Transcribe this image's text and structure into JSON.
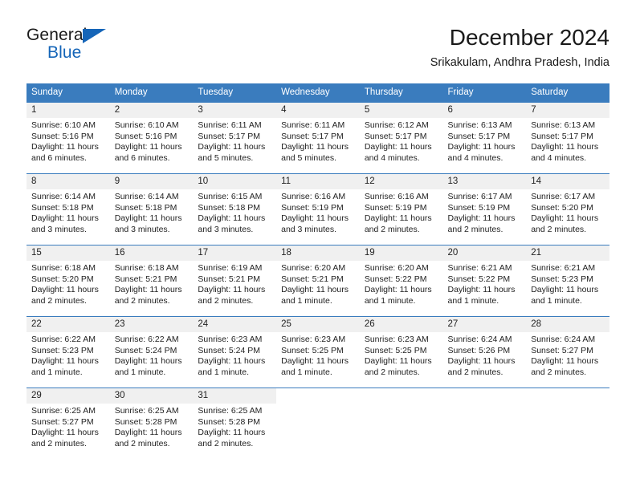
{
  "logo": {
    "word_top": "General",
    "word_bottom": "Blue",
    "triangle_color": "#1565b8",
    "text_color": "#1a1a1a"
  },
  "header": {
    "title": "December 2024",
    "subtitle": "Srikakulam, Andhra Pradesh, India"
  },
  "theme": {
    "header_blue": "#3a7cbe",
    "daynum_band": "#f0f0f0",
    "text": "#222222"
  },
  "calendar": {
    "weekday_headers": [
      "Sunday",
      "Monday",
      "Tuesday",
      "Wednesday",
      "Thursday",
      "Friday",
      "Saturday"
    ],
    "weeks": [
      [
        {
          "day": "1",
          "sunrise": "Sunrise: 6:10 AM",
          "sunset": "Sunset: 5:16 PM",
          "daylight1": "Daylight: 11 hours",
          "daylight2": "and 6 minutes."
        },
        {
          "day": "2",
          "sunrise": "Sunrise: 6:10 AM",
          "sunset": "Sunset: 5:16 PM",
          "daylight1": "Daylight: 11 hours",
          "daylight2": "and 6 minutes."
        },
        {
          "day": "3",
          "sunrise": "Sunrise: 6:11 AM",
          "sunset": "Sunset: 5:17 PM",
          "daylight1": "Daylight: 11 hours",
          "daylight2": "and 5 minutes."
        },
        {
          "day": "4",
          "sunrise": "Sunrise: 6:11 AM",
          "sunset": "Sunset: 5:17 PM",
          "daylight1": "Daylight: 11 hours",
          "daylight2": "and 5 minutes."
        },
        {
          "day": "5",
          "sunrise": "Sunrise: 6:12 AM",
          "sunset": "Sunset: 5:17 PM",
          "daylight1": "Daylight: 11 hours",
          "daylight2": "and 4 minutes."
        },
        {
          "day": "6",
          "sunrise": "Sunrise: 6:13 AM",
          "sunset": "Sunset: 5:17 PM",
          "daylight1": "Daylight: 11 hours",
          "daylight2": "and 4 minutes."
        },
        {
          "day": "7",
          "sunrise": "Sunrise: 6:13 AM",
          "sunset": "Sunset: 5:17 PM",
          "daylight1": "Daylight: 11 hours",
          "daylight2": "and 4 minutes."
        }
      ],
      [
        {
          "day": "8",
          "sunrise": "Sunrise: 6:14 AM",
          "sunset": "Sunset: 5:18 PM",
          "daylight1": "Daylight: 11 hours",
          "daylight2": "and 3 minutes."
        },
        {
          "day": "9",
          "sunrise": "Sunrise: 6:14 AM",
          "sunset": "Sunset: 5:18 PM",
          "daylight1": "Daylight: 11 hours",
          "daylight2": "and 3 minutes."
        },
        {
          "day": "10",
          "sunrise": "Sunrise: 6:15 AM",
          "sunset": "Sunset: 5:18 PM",
          "daylight1": "Daylight: 11 hours",
          "daylight2": "and 3 minutes."
        },
        {
          "day": "11",
          "sunrise": "Sunrise: 6:16 AM",
          "sunset": "Sunset: 5:19 PM",
          "daylight1": "Daylight: 11 hours",
          "daylight2": "and 3 minutes."
        },
        {
          "day": "12",
          "sunrise": "Sunrise: 6:16 AM",
          "sunset": "Sunset: 5:19 PM",
          "daylight1": "Daylight: 11 hours",
          "daylight2": "and 2 minutes."
        },
        {
          "day": "13",
          "sunrise": "Sunrise: 6:17 AM",
          "sunset": "Sunset: 5:19 PM",
          "daylight1": "Daylight: 11 hours",
          "daylight2": "and 2 minutes."
        },
        {
          "day": "14",
          "sunrise": "Sunrise: 6:17 AM",
          "sunset": "Sunset: 5:20 PM",
          "daylight1": "Daylight: 11 hours",
          "daylight2": "and 2 minutes."
        }
      ],
      [
        {
          "day": "15",
          "sunrise": "Sunrise: 6:18 AM",
          "sunset": "Sunset: 5:20 PM",
          "daylight1": "Daylight: 11 hours",
          "daylight2": "and 2 minutes."
        },
        {
          "day": "16",
          "sunrise": "Sunrise: 6:18 AM",
          "sunset": "Sunset: 5:21 PM",
          "daylight1": "Daylight: 11 hours",
          "daylight2": "and 2 minutes."
        },
        {
          "day": "17",
          "sunrise": "Sunrise: 6:19 AM",
          "sunset": "Sunset: 5:21 PM",
          "daylight1": "Daylight: 11 hours",
          "daylight2": "and 2 minutes."
        },
        {
          "day": "18",
          "sunrise": "Sunrise: 6:20 AM",
          "sunset": "Sunset: 5:21 PM",
          "daylight1": "Daylight: 11 hours",
          "daylight2": "and 1 minute."
        },
        {
          "day": "19",
          "sunrise": "Sunrise: 6:20 AM",
          "sunset": "Sunset: 5:22 PM",
          "daylight1": "Daylight: 11 hours",
          "daylight2": "and 1 minute."
        },
        {
          "day": "20",
          "sunrise": "Sunrise: 6:21 AM",
          "sunset": "Sunset: 5:22 PM",
          "daylight1": "Daylight: 11 hours",
          "daylight2": "and 1 minute."
        },
        {
          "day": "21",
          "sunrise": "Sunrise: 6:21 AM",
          "sunset": "Sunset: 5:23 PM",
          "daylight1": "Daylight: 11 hours",
          "daylight2": "and 1 minute."
        }
      ],
      [
        {
          "day": "22",
          "sunrise": "Sunrise: 6:22 AM",
          "sunset": "Sunset: 5:23 PM",
          "daylight1": "Daylight: 11 hours",
          "daylight2": "and 1 minute."
        },
        {
          "day": "23",
          "sunrise": "Sunrise: 6:22 AM",
          "sunset": "Sunset: 5:24 PM",
          "daylight1": "Daylight: 11 hours",
          "daylight2": "and 1 minute."
        },
        {
          "day": "24",
          "sunrise": "Sunrise: 6:23 AM",
          "sunset": "Sunset: 5:24 PM",
          "daylight1": "Daylight: 11 hours",
          "daylight2": "and 1 minute."
        },
        {
          "day": "25",
          "sunrise": "Sunrise: 6:23 AM",
          "sunset": "Sunset: 5:25 PM",
          "daylight1": "Daylight: 11 hours",
          "daylight2": "and 1 minute."
        },
        {
          "day": "26",
          "sunrise": "Sunrise: 6:23 AM",
          "sunset": "Sunset: 5:25 PM",
          "daylight1": "Daylight: 11 hours",
          "daylight2": "and 2 minutes."
        },
        {
          "day": "27",
          "sunrise": "Sunrise: 6:24 AM",
          "sunset": "Sunset: 5:26 PM",
          "daylight1": "Daylight: 11 hours",
          "daylight2": "and 2 minutes."
        },
        {
          "day": "28",
          "sunrise": "Sunrise: 6:24 AM",
          "sunset": "Sunset: 5:27 PM",
          "daylight1": "Daylight: 11 hours",
          "daylight2": "and 2 minutes."
        }
      ],
      [
        {
          "day": "29",
          "sunrise": "Sunrise: 6:25 AM",
          "sunset": "Sunset: 5:27 PM",
          "daylight1": "Daylight: 11 hours",
          "daylight2": "and 2 minutes."
        },
        {
          "day": "30",
          "sunrise": "Sunrise: 6:25 AM",
          "sunset": "Sunset: 5:28 PM",
          "daylight1": "Daylight: 11 hours",
          "daylight2": "and 2 minutes."
        },
        {
          "day": "31",
          "sunrise": "Sunrise: 6:25 AM",
          "sunset": "Sunset: 5:28 PM",
          "daylight1": "Daylight: 11 hours",
          "daylight2": "and 2 minutes."
        },
        {
          "day": "",
          "sunrise": "",
          "sunset": "",
          "daylight1": "",
          "daylight2": ""
        },
        {
          "day": "",
          "sunrise": "",
          "sunset": "",
          "daylight1": "",
          "daylight2": ""
        },
        {
          "day": "",
          "sunrise": "",
          "sunset": "",
          "daylight1": "",
          "daylight2": ""
        },
        {
          "day": "",
          "sunrise": "",
          "sunset": "",
          "daylight1": "",
          "daylight2": ""
        }
      ]
    ]
  }
}
